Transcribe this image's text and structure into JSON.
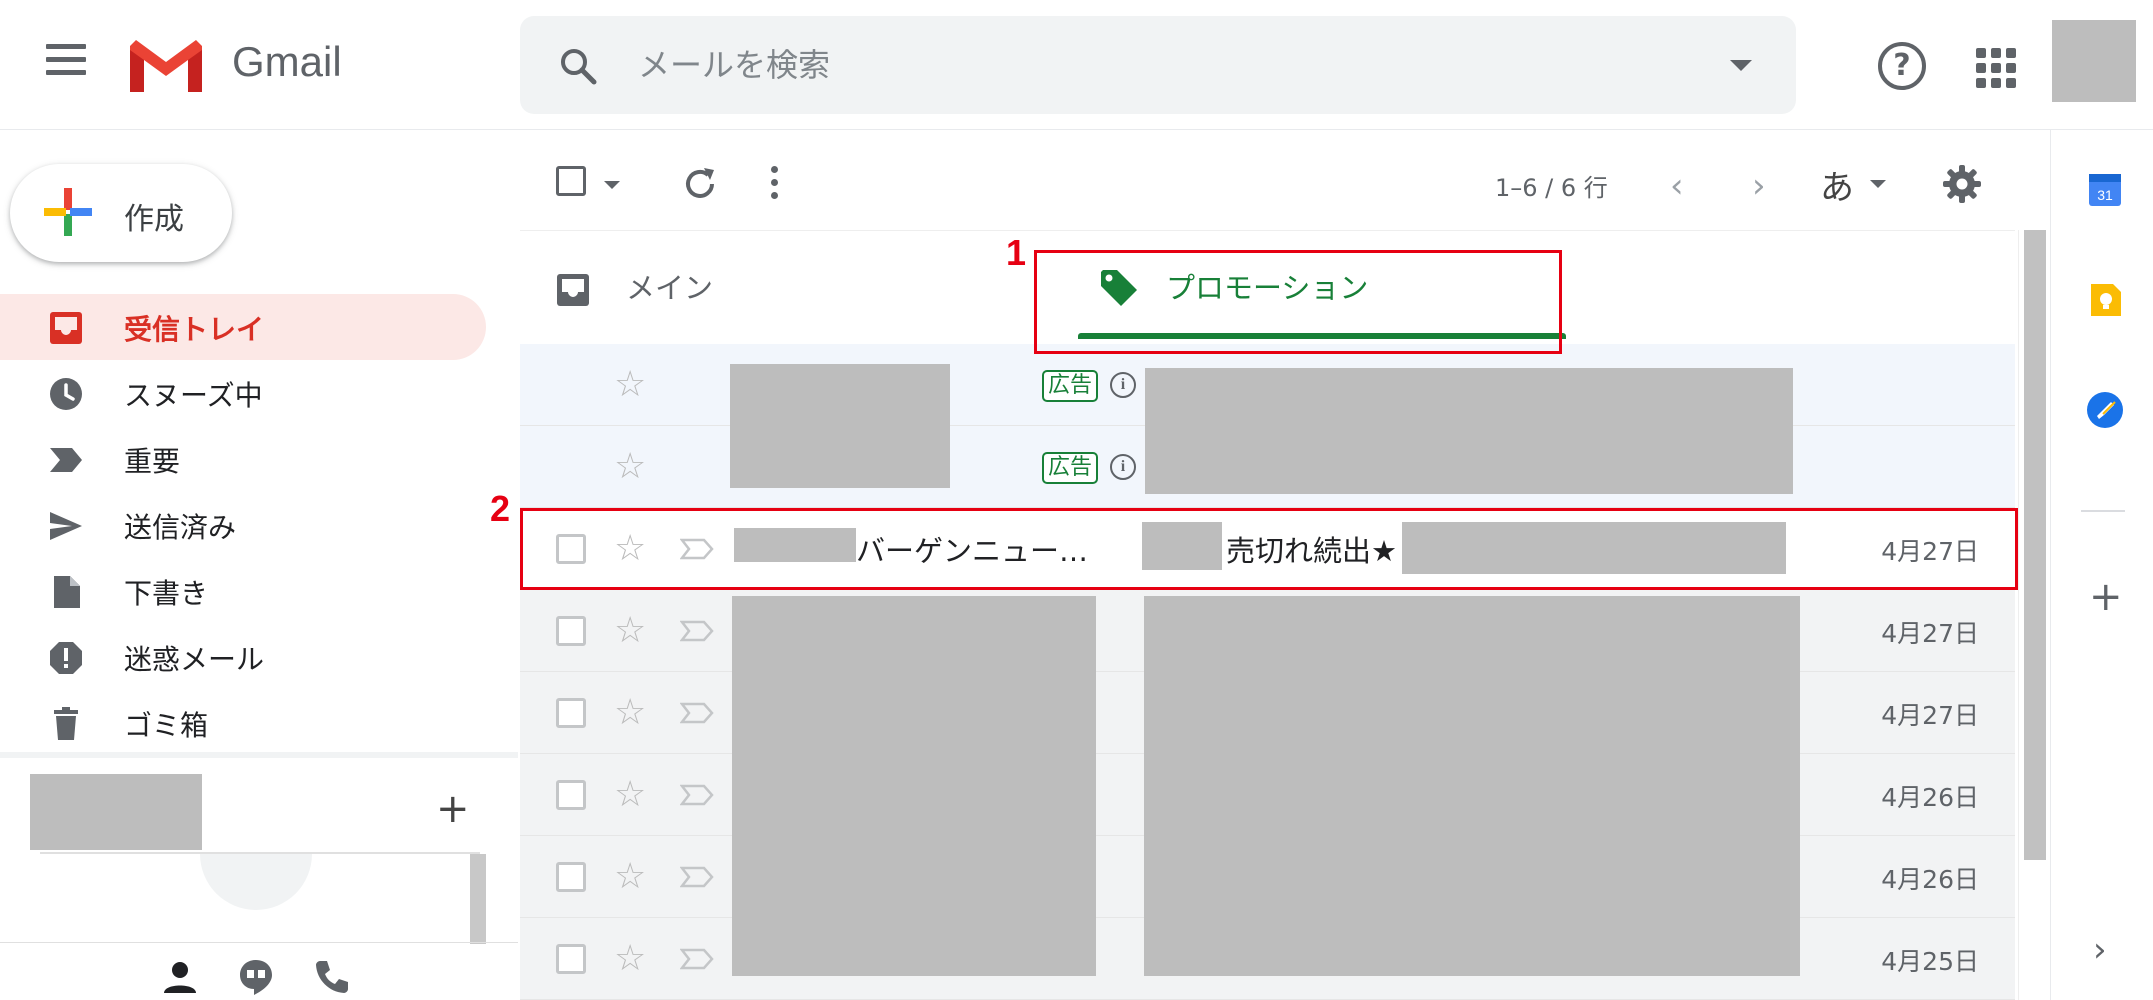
{
  "header": {
    "brand": "Gmail",
    "search_placeholder": "メールを検索"
  },
  "compose": {
    "label": "作成"
  },
  "sidebar": {
    "items": [
      {
        "label": "受信トレイ",
        "icon": "inbox-icon",
        "active": true
      },
      {
        "label": "スヌーズ中",
        "icon": "clock-icon"
      },
      {
        "label": "重要",
        "icon": "label-important-icon"
      },
      {
        "label": "送信済み",
        "icon": "send-icon"
      },
      {
        "label": "下書き",
        "icon": "draft-icon"
      },
      {
        "label": "迷惑メール",
        "icon": "spam-icon"
      },
      {
        "label": "ゴミ箱",
        "icon": "trash-icon"
      }
    ],
    "labels_add": "+"
  },
  "toolbar": {
    "page_info": "1–6 / 6 行",
    "input_tool": "あ"
  },
  "tabs": [
    {
      "label": "メイン",
      "icon": "inbox-icon"
    },
    {
      "label": "プロモーション",
      "icon": "tag-icon",
      "active": true,
      "color": "#188038"
    }
  ],
  "annotations": {
    "box1": "1",
    "box2": "2"
  },
  "emails": [
    {
      "type": "ad",
      "badge": "広告",
      "info": "i"
    },
    {
      "type": "ad",
      "badge": "広告",
      "info": "i"
    },
    {
      "sender": "バーゲンニュー…",
      "subject": "売切れ続出★",
      "date": "4月27日"
    },
    {
      "date": "4月27日"
    },
    {
      "date": "4月27日"
    },
    {
      "date": "4月26日"
    },
    {
      "date": "4月26日"
    },
    {
      "date": "4月25日"
    }
  ],
  "colors": {
    "accent_red": "#d93025",
    "promo_green": "#188038",
    "annotation_red": "#e60012"
  }
}
